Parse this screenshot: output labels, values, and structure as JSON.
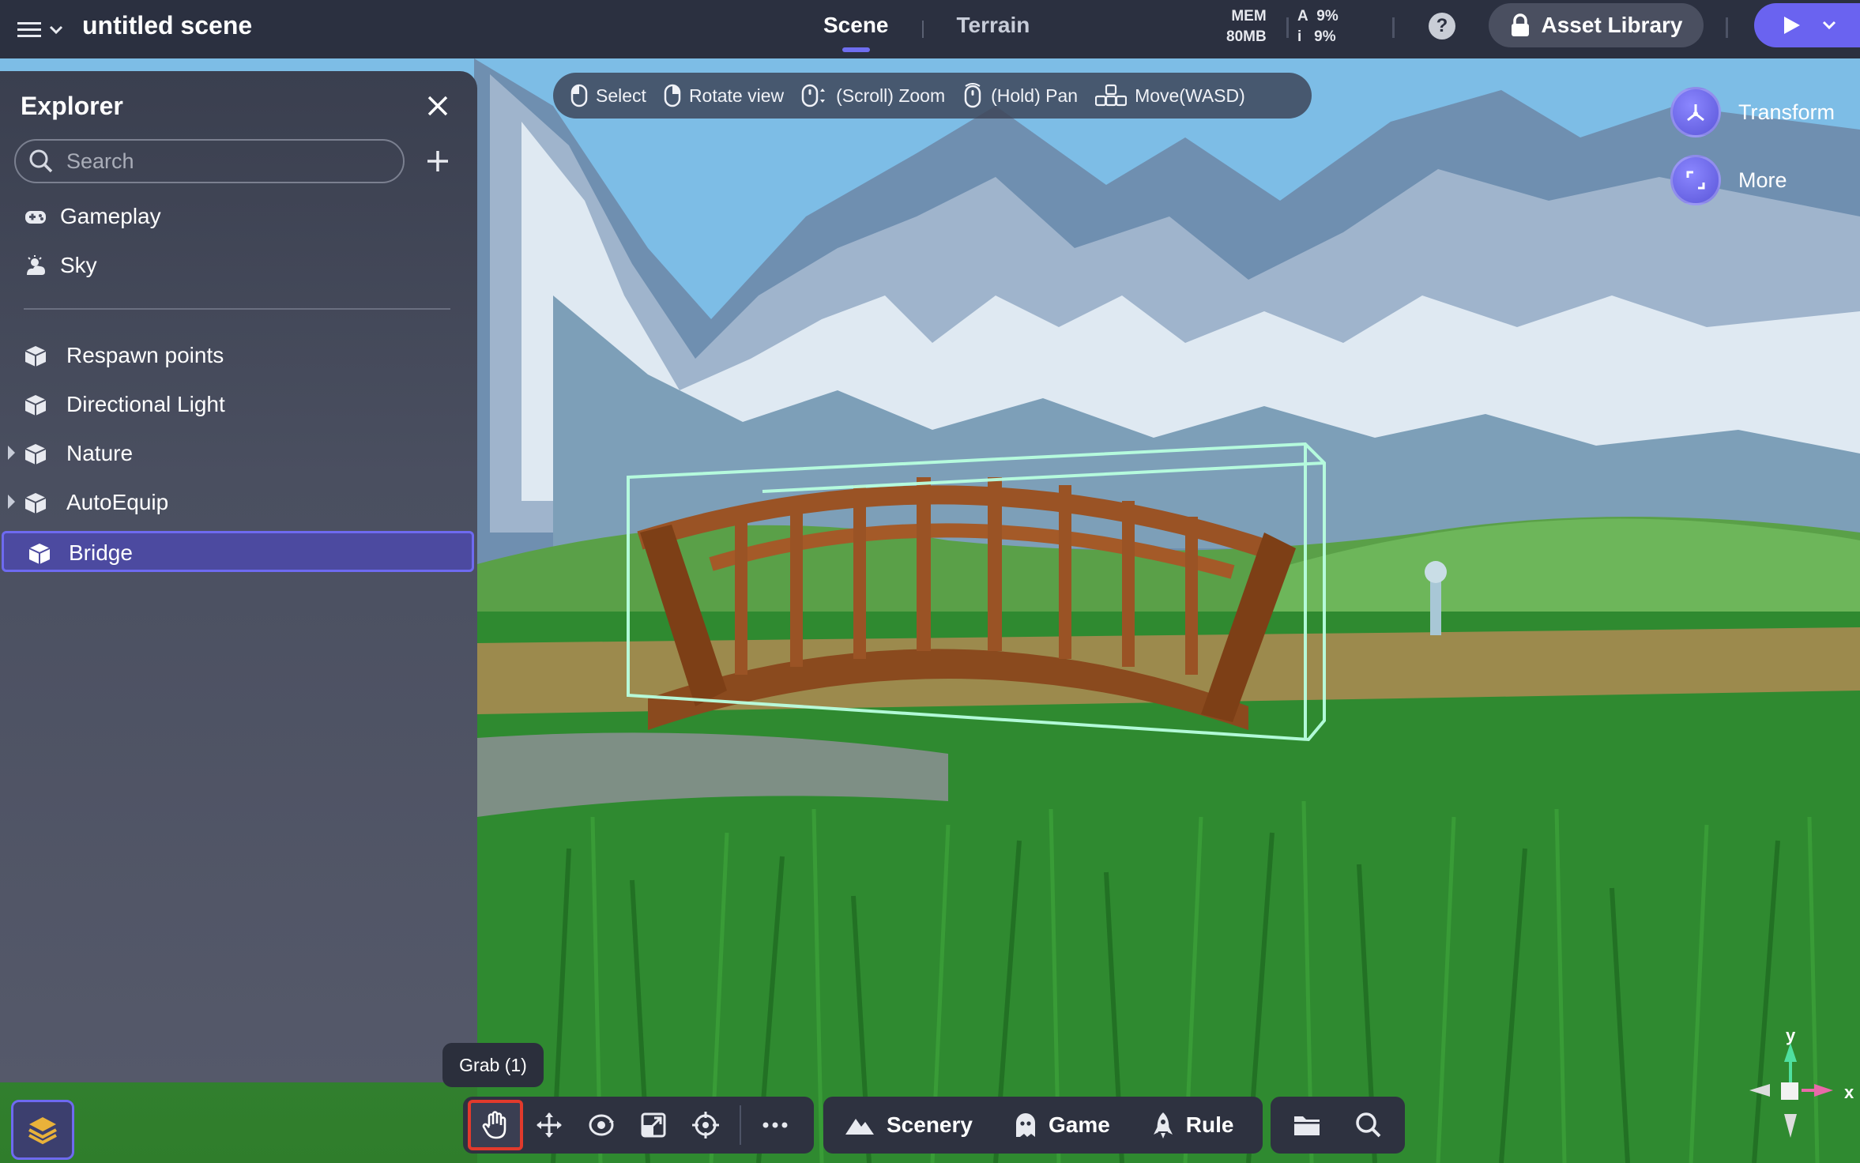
{
  "app": {
    "scene_title": "untitled scene",
    "tabs": [
      {
        "label": "Scene",
        "active": true
      },
      {
        "label": "Terrain",
        "active": false
      }
    ],
    "stats": {
      "mem_label": "MEM",
      "mem_value": "80MB",
      "a_label": "A",
      "a_value": "9%",
      "i_label": "i",
      "i_value": "9%"
    },
    "asset_library_label": "Asset Library"
  },
  "explorer": {
    "title": "Explorer",
    "search_placeholder": "Search",
    "top_items": [
      {
        "label": "Gameplay",
        "icon": "gamepad-icon"
      },
      {
        "label": "Sky",
        "icon": "sky-icon"
      }
    ],
    "objects": [
      {
        "label": "Respawn points",
        "icon": "cube-icon",
        "expandable": false,
        "selected": false
      },
      {
        "label": "Directional Light",
        "icon": "cube-icon",
        "expandable": false,
        "selected": false
      },
      {
        "label": "Nature",
        "icon": "cube-icon",
        "expandable": true,
        "selected": false
      },
      {
        "label": "AutoEquip",
        "icon": "cube-icon",
        "expandable": true,
        "selected": false
      },
      {
        "label": "Bridge",
        "icon": "cube-icon",
        "expandable": false,
        "selected": true
      }
    ]
  },
  "hints": [
    {
      "label": "Select",
      "icon": "mouse-left-icon"
    },
    {
      "label": "Rotate view",
      "icon": "mouse-right-icon"
    },
    {
      "label": "(Scroll) Zoom",
      "icon": "mouse-scroll-icon"
    },
    {
      "label": "(Hold) Pan",
      "icon": "mouse-middle-icon"
    },
    {
      "label": "Move(WASD)",
      "icon": "wasd-keys-icon"
    }
  ],
  "side_actions": [
    {
      "label": "Transform",
      "icon": "transform-icon"
    },
    {
      "label": "More",
      "icon": "more-expand-icon"
    }
  ],
  "toolbar": {
    "tooltip": "Grab (1)",
    "tools": [
      {
        "name": "grab",
        "icon": "hand-icon",
        "active": true
      },
      {
        "name": "move",
        "icon": "move-arrows-icon",
        "active": false
      },
      {
        "name": "rotate",
        "icon": "rotate-icon",
        "active": false
      },
      {
        "name": "scale",
        "icon": "scale-icon",
        "active": false
      },
      {
        "name": "pivot",
        "icon": "pivot-icon",
        "active": false
      },
      {
        "name": "more",
        "icon": "ellipsis-icon",
        "active": false
      }
    ],
    "categories": [
      {
        "label": "Scenery",
        "icon": "mountain-icon"
      },
      {
        "label": "Game",
        "icon": "ghost-icon"
      },
      {
        "label": "Rule",
        "icon": "rocket-icon"
      }
    ],
    "utilities": [
      {
        "name": "folder",
        "icon": "folder-icon"
      },
      {
        "name": "search",
        "icon": "search-icon"
      }
    ]
  },
  "gizmo": {
    "y_label": "y",
    "x_label": "x"
  },
  "colors": {
    "accent": "#6a63f0",
    "topbar": "#2b3040",
    "selection_outline": "#b9ffe0",
    "active_tool_border": "#e23a2c"
  }
}
